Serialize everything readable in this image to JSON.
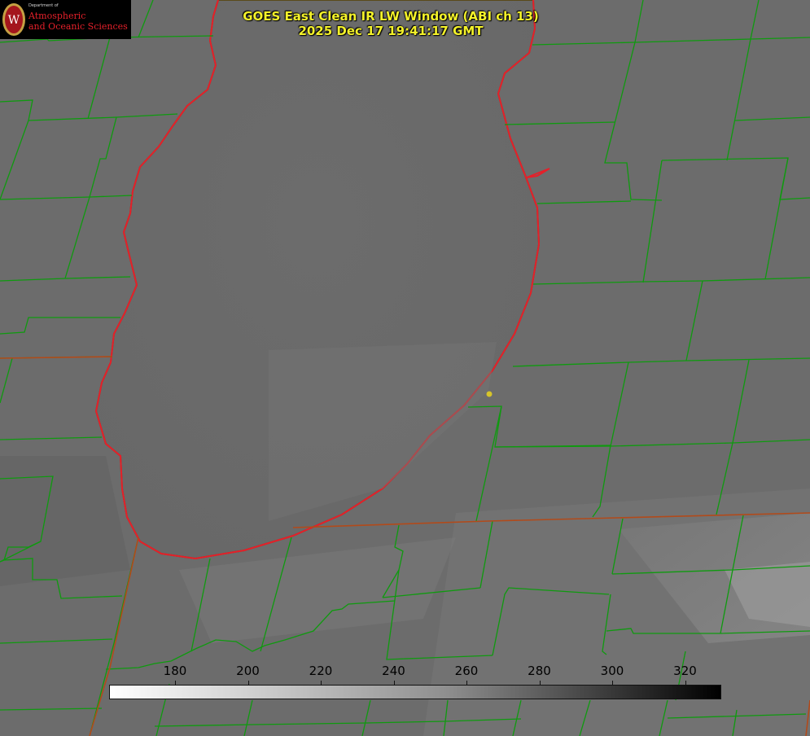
{
  "title": {
    "line1": "GOES East Clean IR LW Window (ABI ch 13)",
    "line2": "2025 Dec 17 19:41:17 GMT"
  },
  "logo": {
    "dept": "Department of",
    "line1": "Atmospheric",
    "line2": "and Oceanic Sciences",
    "crest_letter": "W"
  },
  "colorbar": {
    "ticks": [
      "180",
      "200",
      "220",
      "240",
      "260",
      "280",
      "300",
      "320"
    ],
    "colors": {
      "low": "#ffffff",
      "mid": "#8f8f8f",
      "high": "#000000"
    }
  },
  "colors": {
    "lake_outline": "#e5202a",
    "county_lines": "#0f9a0f",
    "state_lines": "#b24a1a",
    "marker": "#d6c42a",
    "title_text": "#f4f22a"
  }
}
